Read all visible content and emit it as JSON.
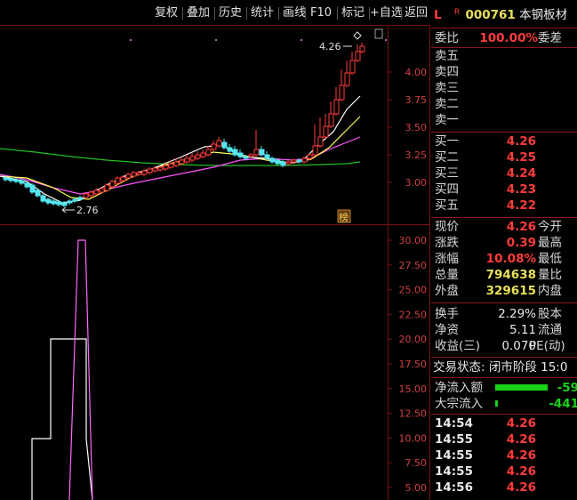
{
  "toolbar": {
    "buttons": [
      "复权",
      "叠加",
      "历史",
      "统计",
      "画线",
      "F10",
      "标记",
      "+自选",
      "返回"
    ]
  },
  "kline": {
    "price_axis": [
      "4.00",
      "3.75",
      "3.50",
      "3.25",
      "3.00"
    ],
    "high_label": "4.26",
    "low_label": "2.76",
    "badge": "榜"
  },
  "indicator": {
    "axis": [
      "30.00",
      "27.50",
      "25.00",
      "22.50",
      "20.00",
      "17.50",
      "15.00",
      "12.50",
      "10.00",
      "7.50",
      "5.00"
    ]
  },
  "stock": {
    "flag": "L",
    "mark": "R",
    "code": "000761",
    "name": "本钢板材"
  },
  "weibi": {
    "label": "委比",
    "value": "100.00%",
    "label2": "委差"
  },
  "sell": [
    {
      "label": "卖五"
    },
    {
      "label": "卖四"
    },
    {
      "label": "卖三"
    },
    {
      "label": "卖二"
    },
    {
      "label": "卖一"
    }
  ],
  "buy": [
    {
      "label": "买一",
      "price": "4.26"
    },
    {
      "label": "买二",
      "price": "4.25"
    },
    {
      "label": "买三",
      "price": "4.24"
    },
    {
      "label": "买四",
      "price": "4.23"
    },
    {
      "label": "买五",
      "price": "4.22"
    }
  ],
  "quote": [
    {
      "label": "现价",
      "value": "4.26",
      "label2": "今开",
      "cls": "red"
    },
    {
      "label": "涨跌",
      "value": "0.39",
      "label2": "最高",
      "cls": "red"
    },
    {
      "label": "涨幅",
      "value": "10.08%",
      "label2": "最低",
      "cls": "red"
    },
    {
      "label": "总量",
      "value": "794638",
      "label2": "量比",
      "cls": "yel"
    },
    {
      "label": "外盘",
      "value": "329615",
      "label2": "内盘",
      "cls": "yel"
    }
  ],
  "stats": [
    {
      "label": "换手",
      "value": "2.29%",
      "label2": "股本"
    },
    {
      "label": "净资",
      "value": "5.11",
      "label2": "流通"
    },
    {
      "label": "收益(三)",
      "value": "0.070",
      "label2": "PE(动)"
    }
  ],
  "trade_status": "交易状态: 闭市阶段 15:0",
  "flows": [
    {
      "label": "净流入额",
      "value": "-59",
      "bar": 0.65
    },
    {
      "label": "大宗流入",
      "value": "-441",
      "bar": 0.03
    }
  ],
  "ticks": [
    {
      "time": "14:54",
      "price": "4.26"
    },
    {
      "time": "14:55",
      "price": "4.26"
    },
    {
      "time": "14:55",
      "price": "4.26"
    },
    {
      "time": "14:55",
      "price": "4.26"
    },
    {
      "time": "14:56",
      "price": "4.26"
    },
    {
      "time": "",
      "price": ""
    }
  ],
  "colors": {
    "up": "#ff3c3c",
    "down": "#54e6f0",
    "ma5": "#ffffff",
    "ma10": "#ffff55",
    "ma20": "#ff55ff",
    "ma60": "#22c022",
    "frame": "#7a1010",
    "flow_bar": "#19d219"
  }
}
